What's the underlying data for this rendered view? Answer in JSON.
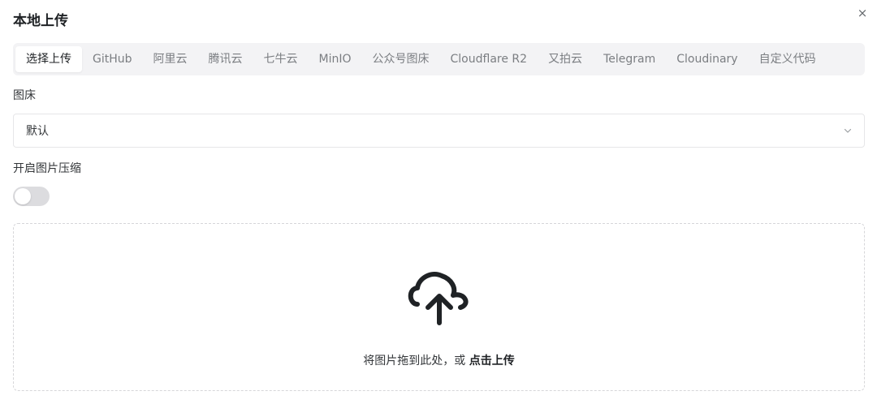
{
  "dialog": {
    "title": "本地上传",
    "close_label": "×"
  },
  "tabs": [
    {
      "label": "选择上传",
      "active": true
    },
    {
      "label": "GitHub",
      "active": false
    },
    {
      "label": "阿里云",
      "active": false
    },
    {
      "label": "腾讯云",
      "active": false
    },
    {
      "label": "七牛云",
      "active": false
    },
    {
      "label": "MinIO",
      "active": false
    },
    {
      "label": "公众号图床",
      "active": false
    },
    {
      "label": "Cloudflare R2",
      "active": false
    },
    {
      "label": "又拍云",
      "active": false
    },
    {
      "label": "Telegram",
      "active": false
    },
    {
      "label": "Cloudinary",
      "active": false
    },
    {
      "label": "自定义代码",
      "active": false
    }
  ],
  "image_bed": {
    "label": "图床",
    "selected": "默认",
    "arrow_icon": "chevron-down-icon"
  },
  "compression": {
    "label": "开启图片压缩",
    "enabled": false
  },
  "dropzone": {
    "icon": "cloud-upload-icon",
    "hint_prefix": "将图片拖到此处，或",
    "hint_action": "点击上传"
  }
}
